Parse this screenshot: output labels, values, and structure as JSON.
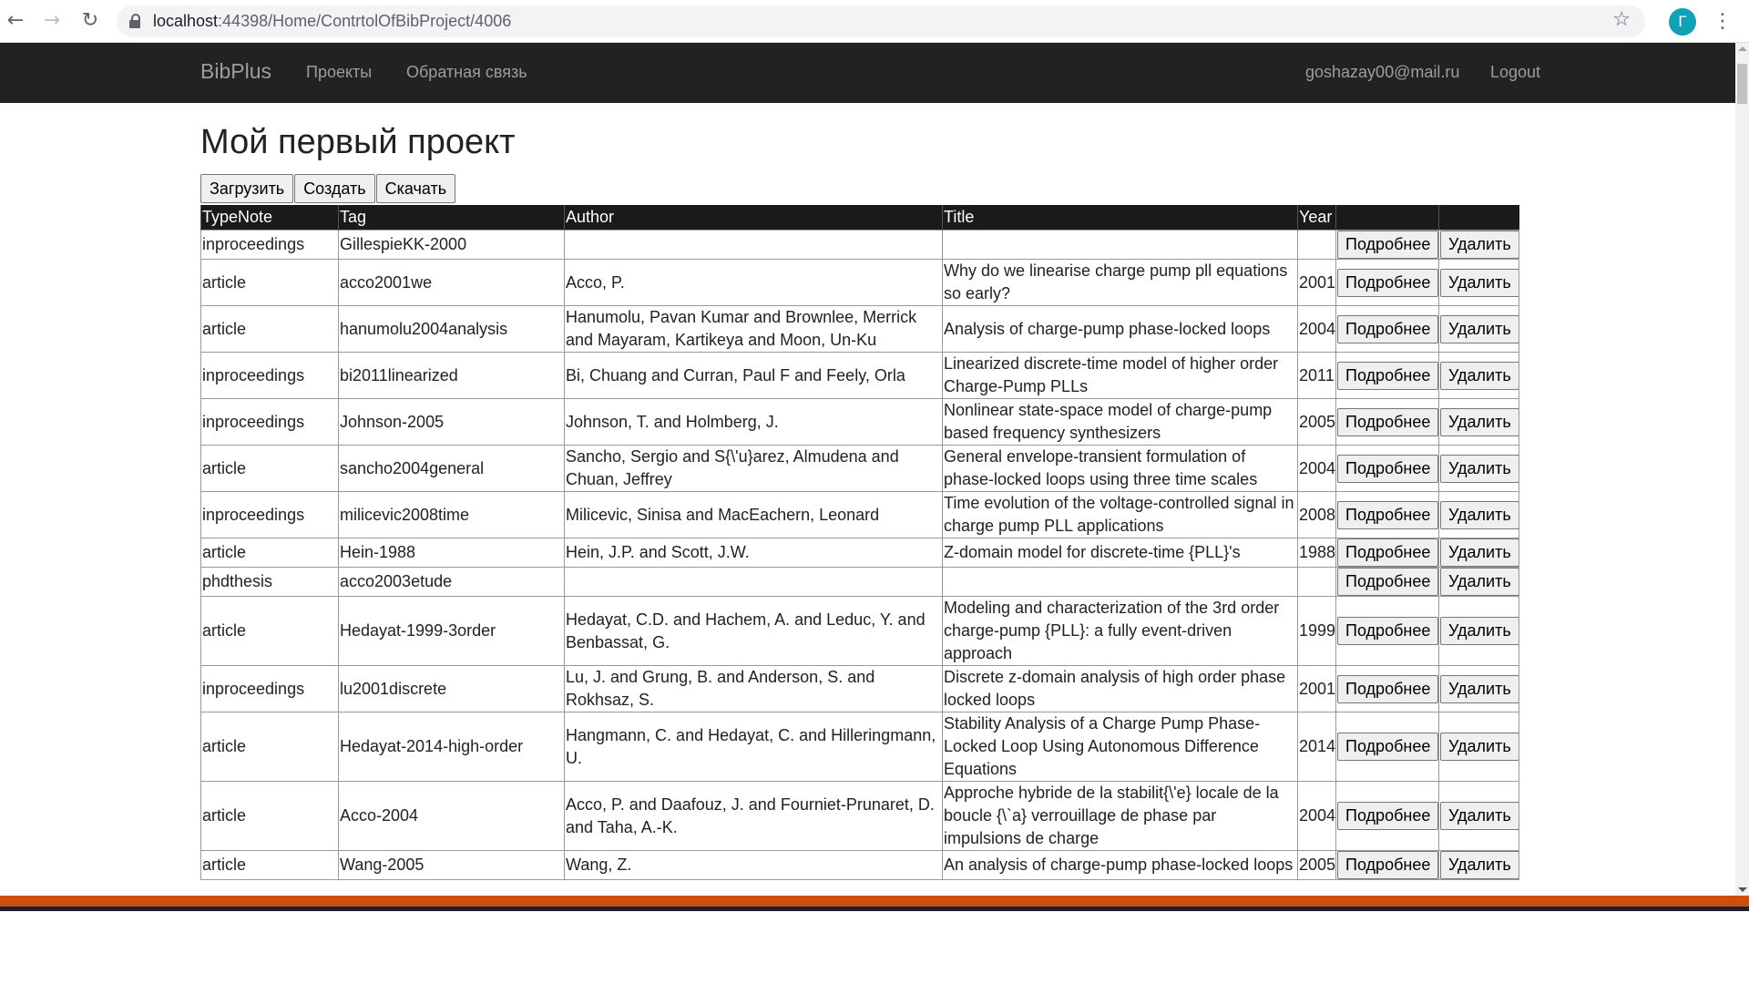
{
  "browser": {
    "url_host": "localhost",
    "url_rest": ":44398/Home/ContrtolOfBibProject/4006",
    "profile_initial": "Г",
    "icons": [
      "back-icon",
      "forward-icon",
      "reload-icon",
      "lock-icon",
      "star-icon",
      "menu-icon"
    ]
  },
  "navbar": {
    "brand": "BibPlus",
    "projects": "Проекты",
    "feedback": "Обратная связь",
    "email": "goshazay00@mail.ru",
    "logout": "Logout"
  },
  "page": {
    "title": "Мой первый проект",
    "upload": "Загрузить",
    "create": "Создать",
    "download": "Скачать"
  },
  "table": {
    "headers": [
      "TypeNote",
      "Tag",
      "Author",
      "Title",
      "Year",
      "",
      ""
    ],
    "details_label": "Подробнее",
    "delete_label": "Удалить",
    "rows": [
      {
        "type": "inproceedings",
        "tag": "GillespieKK-2000",
        "author": "",
        "title": "",
        "year": ""
      },
      {
        "type": "article",
        "tag": "acco2001we",
        "author": "Acco, P.",
        "title": "Why do we linearise charge pump pll equations so early?",
        "year": "2001"
      },
      {
        "type": "article",
        "tag": "hanumolu2004analysis",
        "author": "Hanumolu, Pavan Kumar and Brownlee, Merrick and Mayaram, Kartikeya and Moon, Un-Ku",
        "title": "Analysis of charge-pump phase-locked loops",
        "year": "2004"
      },
      {
        "type": "inproceedings",
        "tag": "bi2011linearized",
        "author": "Bi, Chuang and Curran, Paul F and Feely, Orla",
        "title": "Linearized discrete-time model of higher order Charge-Pump PLLs",
        "year": "2011"
      },
      {
        "type": "inproceedings",
        "tag": "Johnson-2005",
        "author": "Johnson, T. and Holmberg, J.",
        "title": "Nonlinear state-space model of charge-pump based frequency synthesizers",
        "year": "2005"
      },
      {
        "type": "article",
        "tag": "sancho2004general",
        "author": "Sancho, Sergio and S{\\'u}arez, Almudena and Chuan, Jeffrey",
        "title": "General envelope-transient formulation of phase-locked loops using three time scales",
        "year": "2004"
      },
      {
        "type": "inproceedings",
        "tag": "milicevic2008time",
        "author": "Milicevic, Sinisa and MacEachern, Leonard",
        "title": "Time evolution of the voltage-controlled signal in charge pump PLL applications",
        "year": "2008"
      },
      {
        "type": "article",
        "tag": "Hein-1988",
        "author": "Hein, J.P. and Scott, J.W.",
        "title": "Z-domain model for discrete-time {PLL}'s",
        "year": "1988"
      },
      {
        "type": "phdthesis",
        "tag": "acco2003etude",
        "author": "",
        "title": "",
        "year": ""
      },
      {
        "type": "article",
        "tag": "Hedayat-1999-3order",
        "author": "Hedayat, C.D. and Hachem, A. and Leduc, Y. and Benbassat, G.",
        "title": "Modeling and characterization of the 3rd order charge-pump {PLL}: a fully event-driven approach",
        "year": "1999"
      },
      {
        "type": "inproceedings",
        "tag": "lu2001discrete",
        "author": "Lu, J. and Grung, B. and Anderson, S. and Rokhsaz, S.",
        "title": "Discrete z-domain analysis of high order phase locked loops",
        "year": "2001"
      },
      {
        "type": "article",
        "tag": "Hedayat-2014-high-order",
        "author": "Hangmann, C. and Hedayat, C. and Hilleringmann, U.",
        "title": "Stability Analysis of a Charge Pump Phase-Locked Loop Using Autonomous Difference Equations",
        "year": "2014"
      },
      {
        "type": "article",
        "tag": "Acco-2004",
        "author": "Acco, P. and Daafouz, J. and Fourniet-Prunaret, D. and Taha, A.-K.",
        "title": "Approche hybride de la stabilit{\\'e} locale de la boucle {\\`a} verrouillage de phase par impulsions de charge",
        "year": "2004"
      },
      {
        "type": "article",
        "tag": "Wang-2005",
        "author": "Wang, Z.",
        "title": "An analysis of charge-pump phase-locked loops",
        "year": "2005"
      }
    ]
  }
}
